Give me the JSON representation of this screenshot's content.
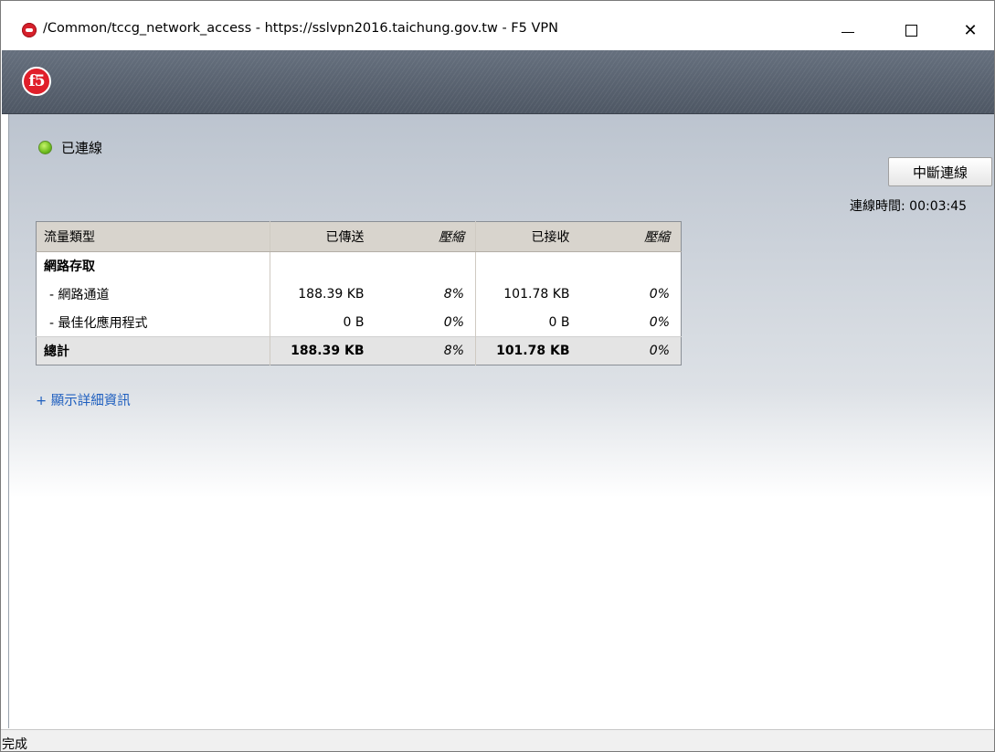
{
  "window": {
    "title": "/Common/tccg_network_access - https://sslvpn2016.taichung.gov.tw - F5 VPN",
    "minimize_symbol": "",
    "maximize_symbol": "",
    "close_symbol": "✕"
  },
  "banner": {
    "logo_text": "f5",
    "brand_color": "#e01f2a"
  },
  "status": {
    "label": "已連線",
    "indicator_color": "#6fbd1f"
  },
  "disconnect_button": {
    "label": "中斷連線"
  },
  "connection_time": {
    "text": "連線時間: 00:03:45"
  },
  "traffic_table": {
    "headers": {
      "type": "流量類型",
      "sent": "已傳送",
      "sent_compression": "壓縮",
      "received": "已接收",
      "received_compression": "壓縮"
    },
    "group": {
      "label": "網路存取"
    },
    "rows": [
      {
        "type": "- 網路通道",
        "sent": "188.39 KB",
        "sent_compression": "8%",
        "received": "101.78 KB",
        "received_compression": "0%"
      },
      {
        "type": "- 最佳化應用程式",
        "sent": "0 B",
        "sent_compression": "0%",
        "received": "0 B",
        "received_compression": "0%"
      }
    ],
    "total": {
      "type": "總計",
      "sent": "188.39 KB",
      "sent_compression": "8%",
      "received": "101.78 KB",
      "received_compression": "0%"
    }
  },
  "details_link": {
    "label": "+ 顯示詳細資訊",
    "color": "#1f5fbf"
  },
  "statusbar": {
    "text": "完成"
  }
}
